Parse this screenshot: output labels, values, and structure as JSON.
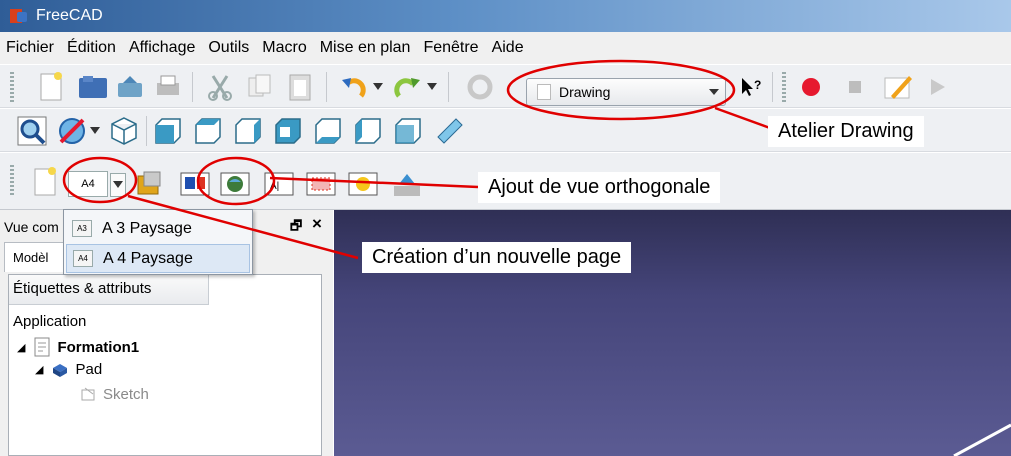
{
  "window": {
    "title": "FreeCAD"
  },
  "menu": [
    "Fichier",
    "Édition",
    "Affichage",
    "Outils",
    "Macro",
    "Mise en plan",
    "Fenêtre",
    "Aide"
  ],
  "toolbar": {
    "workbench": "Drawing",
    "a4_label": "A4",
    "whatsthis": "?"
  },
  "combo_view": {
    "title": "Vue com",
    "tab": "Modèl",
    "column": "Étiquettes & attributs",
    "close": "×"
  },
  "tree": {
    "root": "Application",
    "doc": "Formation1",
    "pad": "Pad",
    "sketch": "Sketch"
  },
  "popup": {
    "items": [
      {
        "badge": "A3",
        "label": "A 3 Paysage"
      },
      {
        "badge": "A4",
        "label": "A 4 Paysage"
      }
    ]
  },
  "annotations": {
    "atelier": "Atelier Drawing",
    "ortho": "Ajout de vue orthogonale",
    "page": "Création d’un nouvelle page"
  },
  "colors": {
    "annotation": "#e00000",
    "viewport": "#45457a"
  }
}
